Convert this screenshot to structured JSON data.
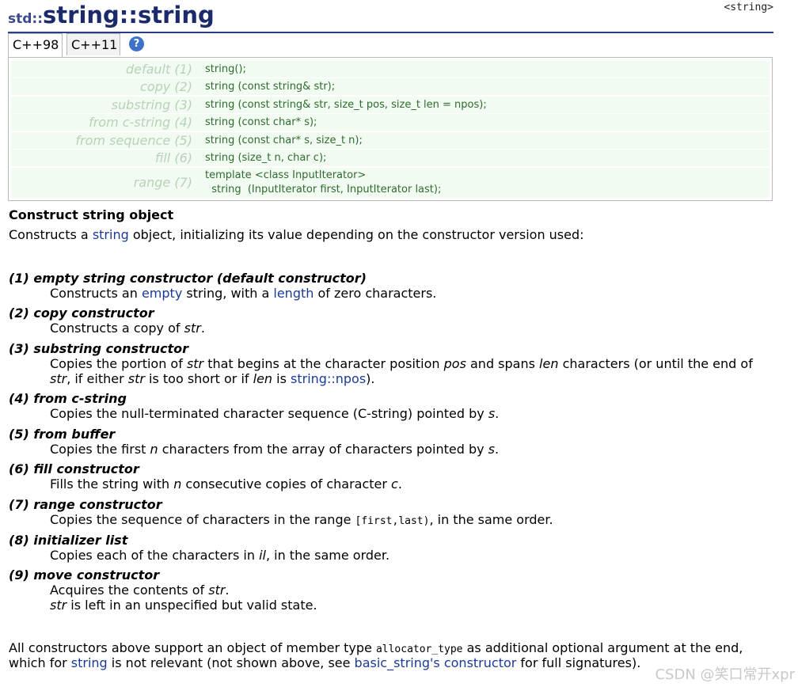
{
  "header": {
    "namespace": "std::",
    "name": "string::string",
    "tag": "<string>"
  },
  "tabs": [
    {
      "label": "C++98"
    },
    {
      "label": "C++11"
    }
  ],
  "help_icon_glyph": "?",
  "prototypes": [
    {
      "label": "default (1)",
      "code": "string();"
    },
    {
      "label": "copy (2)",
      "code": "string (const string& str);"
    },
    {
      "label": "substring (3)",
      "code": "string (const string& str, size_t pos, size_t len = npos);"
    },
    {
      "label": "from c-string (4)",
      "code": "string (const char* s);"
    },
    {
      "label": "from sequence (5)",
      "code": "string (const char* s, size_t n);"
    },
    {
      "label": "fill (6)",
      "code": "string (size_t n, char c);"
    },
    {
      "label": "range (7)",
      "code": "template <class InputIterator>\n  string  (InputIterator first, InputIterator last);"
    }
  ],
  "section_heading": "Construct string object",
  "intro": {
    "before": "Constructs a ",
    "link": "string",
    "after": " object, initializing its value depending on the constructor version used:"
  },
  "constructors": [
    {
      "title": "(1) empty string constructor (default constructor)",
      "lines": [
        [
          {
            "t": "Constructs an "
          },
          {
            "t": "empty",
            "link": true
          },
          {
            "t": " string, with a "
          },
          {
            "t": "length",
            "link": true
          },
          {
            "t": " of zero characters."
          }
        ]
      ]
    },
    {
      "title": "(2) copy constructor",
      "lines": [
        [
          {
            "t": "Constructs a copy of "
          },
          {
            "t": "str",
            "em": true
          },
          {
            "t": "."
          }
        ]
      ]
    },
    {
      "title": "(3) substring constructor",
      "lines": [
        [
          {
            "t": "Copies the portion of "
          },
          {
            "t": "str",
            "em": true
          },
          {
            "t": " that begins at the character position "
          },
          {
            "t": "pos",
            "em": true
          },
          {
            "t": " and spans "
          },
          {
            "t": "len",
            "em": true
          },
          {
            "t": " characters (or until the end of"
          }
        ],
        [
          {
            "t": "str",
            "em": true
          },
          {
            "t": ", if either "
          },
          {
            "t": "str",
            "em": true
          },
          {
            "t": " is too short or if "
          },
          {
            "t": "len",
            "em": true
          },
          {
            "t": " is "
          },
          {
            "t": "string::npos",
            "link": true
          },
          {
            "t": ")."
          }
        ]
      ]
    },
    {
      "title": "(4) from c-string",
      "lines": [
        [
          {
            "t": "Copies the null-terminated character sequence (C-string) pointed by "
          },
          {
            "t": "s",
            "em": true
          },
          {
            "t": "."
          }
        ]
      ]
    },
    {
      "title": "(5) from buffer",
      "lines": [
        [
          {
            "t": "Copies the first "
          },
          {
            "t": "n",
            "em": true
          },
          {
            "t": " characters from the array of characters pointed by "
          },
          {
            "t": "s",
            "em": true
          },
          {
            "t": "."
          }
        ]
      ]
    },
    {
      "title": "(6) fill constructor",
      "lines": [
        [
          {
            "t": "Fills the string with "
          },
          {
            "t": "n",
            "em": true
          },
          {
            "t": " consecutive copies of character "
          },
          {
            "t": "c",
            "em": true
          },
          {
            "t": "."
          }
        ]
      ]
    },
    {
      "title": "(7) range constructor",
      "lines": [
        [
          {
            "t": "Copies the sequence of characters in the range "
          },
          {
            "t": "[first,last)",
            "code": true
          },
          {
            "t": ", in the same order."
          }
        ]
      ]
    },
    {
      "title": "(8) initializer list",
      "lines": [
        [
          {
            "t": "Copies each of the characters in "
          },
          {
            "t": "il",
            "em": true
          },
          {
            "t": ", in the same order."
          }
        ]
      ]
    },
    {
      "title": "(9) move constructor",
      "lines": [
        [
          {
            "t": "Acquires the contents of "
          },
          {
            "t": "str",
            "em": true
          },
          {
            "t": "."
          }
        ],
        [
          {
            "t": "str",
            "em": true
          },
          {
            "t": " is left in an unspecified but valid state."
          }
        ]
      ]
    }
  ],
  "footer_lines": [
    [
      {
        "t": "All constructors above support an object of member type "
      },
      {
        "t": "allocator_type",
        "code": true
      },
      {
        "t": " as additional optional argument at the end,"
      }
    ],
    [
      {
        "t": "which for "
      },
      {
        "t": "string",
        "link": true
      },
      {
        "t": " is not relevant (not shown above, see "
      },
      {
        "t": "basic_string",
        "link": true
      },
      {
        "t": "'s constructor",
        "link": true
      },
      {
        "t": " for full signatures)."
      }
    ]
  ],
  "watermark": "CSDN @笑口常开xpr"
}
